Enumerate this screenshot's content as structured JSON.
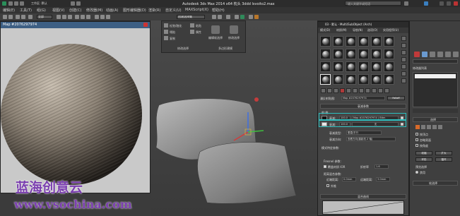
{
  "window": {
    "title": "Autodesk 3ds Max  2014 x64        枕头 3ddd lsvoito2.max",
    "search_placeholder": "键入关键字或短语",
    "top_left_label": "工作区: 默认"
  },
  "menu": [
    "编辑(E)",
    "工具(T)",
    "组(G)",
    "视图(V)",
    "创建(C)",
    "修改器(M)",
    "动画(A)",
    "图形编辑器(D)",
    "渲染(R)",
    "自定义(U)",
    "MAXScript(X)",
    "帮助(H)"
  ],
  "toolbar": {
    "selection_dropdown": "全部",
    "named_set": "创建选择集"
  },
  "ribbon": {
    "labels": [
      "松弛/融化",
      "塌陷",
      "复制",
      "粘贴",
      "属性",
      "编辑软选择",
      "修改选择",
      "多边形建模"
    ],
    "panel_title": "修改选择"
  },
  "preview": {
    "title": "Map #2076297974",
    "texture": "woven-fabric-sphere"
  },
  "material_editor": {
    "title": "03 - 默认 - Multi/SubObject (Arch)",
    "menu": [
      "模式(D)",
      "材质(M)",
      "导航(N)",
      "选项(O)",
      "实用程序(U)"
    ],
    "material_name_label": "漫反射贴图:",
    "material_name": "Map #2076297974",
    "type_button": "Falloff",
    "rollouts": {
      "params": "衰减参数",
      "mix": "混合曲线",
      "output": "输出"
    },
    "front_side_label": "前:侧",
    "rows": [
      {
        "label": "衰减:",
        "value": "100.0",
        "map": "Map #2076297974 ( Bitm"
      },
      {
        "label": "衰减:",
        "value": "100.0",
        "map": "无"
      }
    ],
    "falloff_type_label": "衰减类型:",
    "falloff_type": "垂直/平行",
    "falloff_dir_label": "衰减方向:",
    "falloff_dir": "查看方向(摄影机 Z 轴)",
    "mode_specific": "模式特定参数:",
    "fresnel_label": "Fresnel 参数:",
    "override_label": "覆盖材质 IOR",
    "ior_label": "折射率",
    "ior_value": "1.6",
    "dist_label": "距离混合参数:",
    "near_label": "近端距离:",
    "near_value": "0.0mm",
    "far_label": "远端距离:",
    "far_value": "3.0mm",
    "extrapolate_label": "外推"
  },
  "command_panel": {
    "modifier_list": "修改器列表",
    "section_label": "选择",
    "vertex_label": "按顶点",
    "ignore_back": "忽略背面",
    "angle_label": "按角度",
    "shrink": "收缩",
    "grow": "扩大",
    "ring": "环形",
    "loop": "循环",
    "preview_select": "预览选择",
    "off": "禁用",
    "soft_select": "软选择"
  },
  "watermark": {
    "line1": "蓝海创意云",
    "line2": "www.vsochina.com"
  }
}
